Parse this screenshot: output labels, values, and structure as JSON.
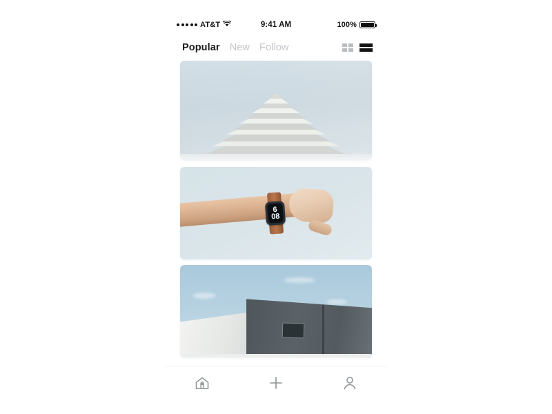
{
  "status_bar": {
    "signal_dots": 5,
    "carrier": "AT&T",
    "wifi_icon": "wifi-icon",
    "time": "9:41 AM",
    "battery_percent": "100%",
    "battery_icon": "battery-full-icon"
  },
  "header": {
    "tabs": [
      {
        "label": "Popular",
        "active": true
      },
      {
        "label": "New",
        "active": false
      },
      {
        "label": "Follow",
        "active": false
      }
    ],
    "view_toggles": [
      {
        "name": "grid-view-toggle",
        "icon": "grid-icon",
        "active": false,
        "color": "#b9bdc1"
      },
      {
        "name": "list-view-toggle",
        "icon": "list-icon",
        "active": true,
        "color": "#131313"
      }
    ]
  },
  "feed": {
    "cards": [
      {
        "name": "feed-card-architecture",
        "alt": "Stepped concrete building apex against pale blue sky",
        "sky_color": "#cdd9e0",
        "subject_color": "#e8eaea"
      },
      {
        "name": "feed-card-smartwatch",
        "alt": "Forearm wearing a smartwatch with tan leather strap on pale blue background",
        "sky_color": "#dae5ea",
        "watch_time_hour": "6",
        "watch_time_minute": "08",
        "strap_color": "#b9764b"
      },
      {
        "name": "feed-card-building",
        "alt": "Dark grey concrete building corner with small window against blue sky",
        "sky_color": "#b7d2e1",
        "subject_color": "#545b60"
      }
    ]
  },
  "tabbar": {
    "items": [
      {
        "name": "tabbar-item-home",
        "icon": "home-icon",
        "active": false
      },
      {
        "name": "tabbar-item-add",
        "icon": "plus-icon",
        "active": false
      },
      {
        "name": "tabbar-item-profile",
        "icon": "person-icon",
        "active": false
      }
    ],
    "icon_color": "#8d9295"
  }
}
